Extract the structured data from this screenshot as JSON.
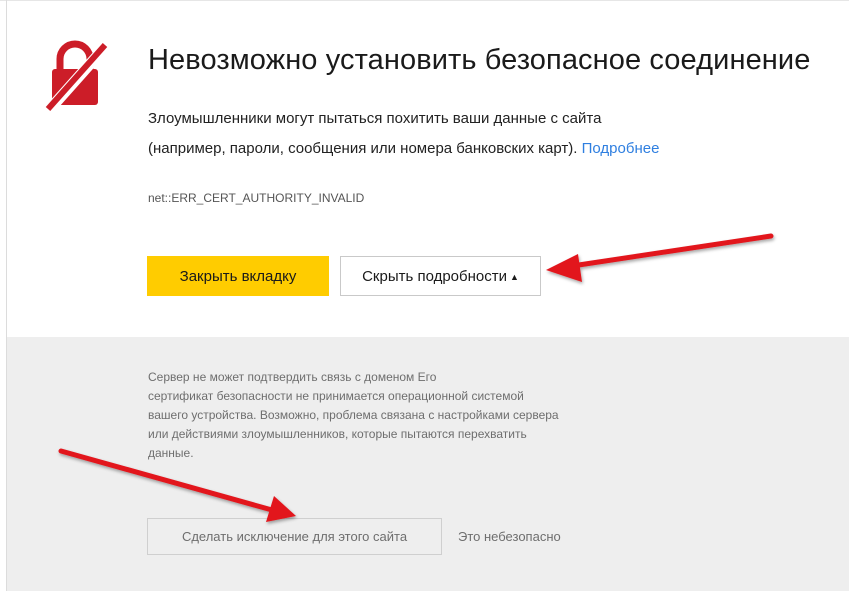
{
  "error": {
    "title": "Невозможно установить безопасное соединение",
    "description_line1": "Злоумышленники могут пытаться похитить ваши данные с сайта",
    "description_line2": "(например, пароли, сообщения или номера банковских карт).",
    "more_link": "Подробнее",
    "error_code": "net::ERR_CERT_AUTHORITY_INVALID"
  },
  "actions": {
    "close_tab_label": "Закрыть вкладку",
    "hide_details_label": "Скрыть подробности",
    "hide_details_caret": "▲"
  },
  "details": {
    "lines": [
      "Сервер не может подтвердить связь с доменом                       Его",
      "сертификат безопасности не принимается операционной системой",
      "вашего устройства. Возможно, проблема связана с настройками сервера",
      "или действиями злоумышленников, которые пытаются перехватить",
      "данные."
    ],
    "exception_button_label": "Сделать исключение для этого сайта",
    "unsafe_label": "Это небезопасно"
  },
  "icons": {
    "lock": "broken-lock-icon"
  },
  "colors": {
    "primary_button": "#ffcc00",
    "link": "#2f7fe0",
    "lock_icon": "#cc1d28",
    "annotation_arrow": "#e2141c",
    "details_background": "#eeeeee"
  }
}
